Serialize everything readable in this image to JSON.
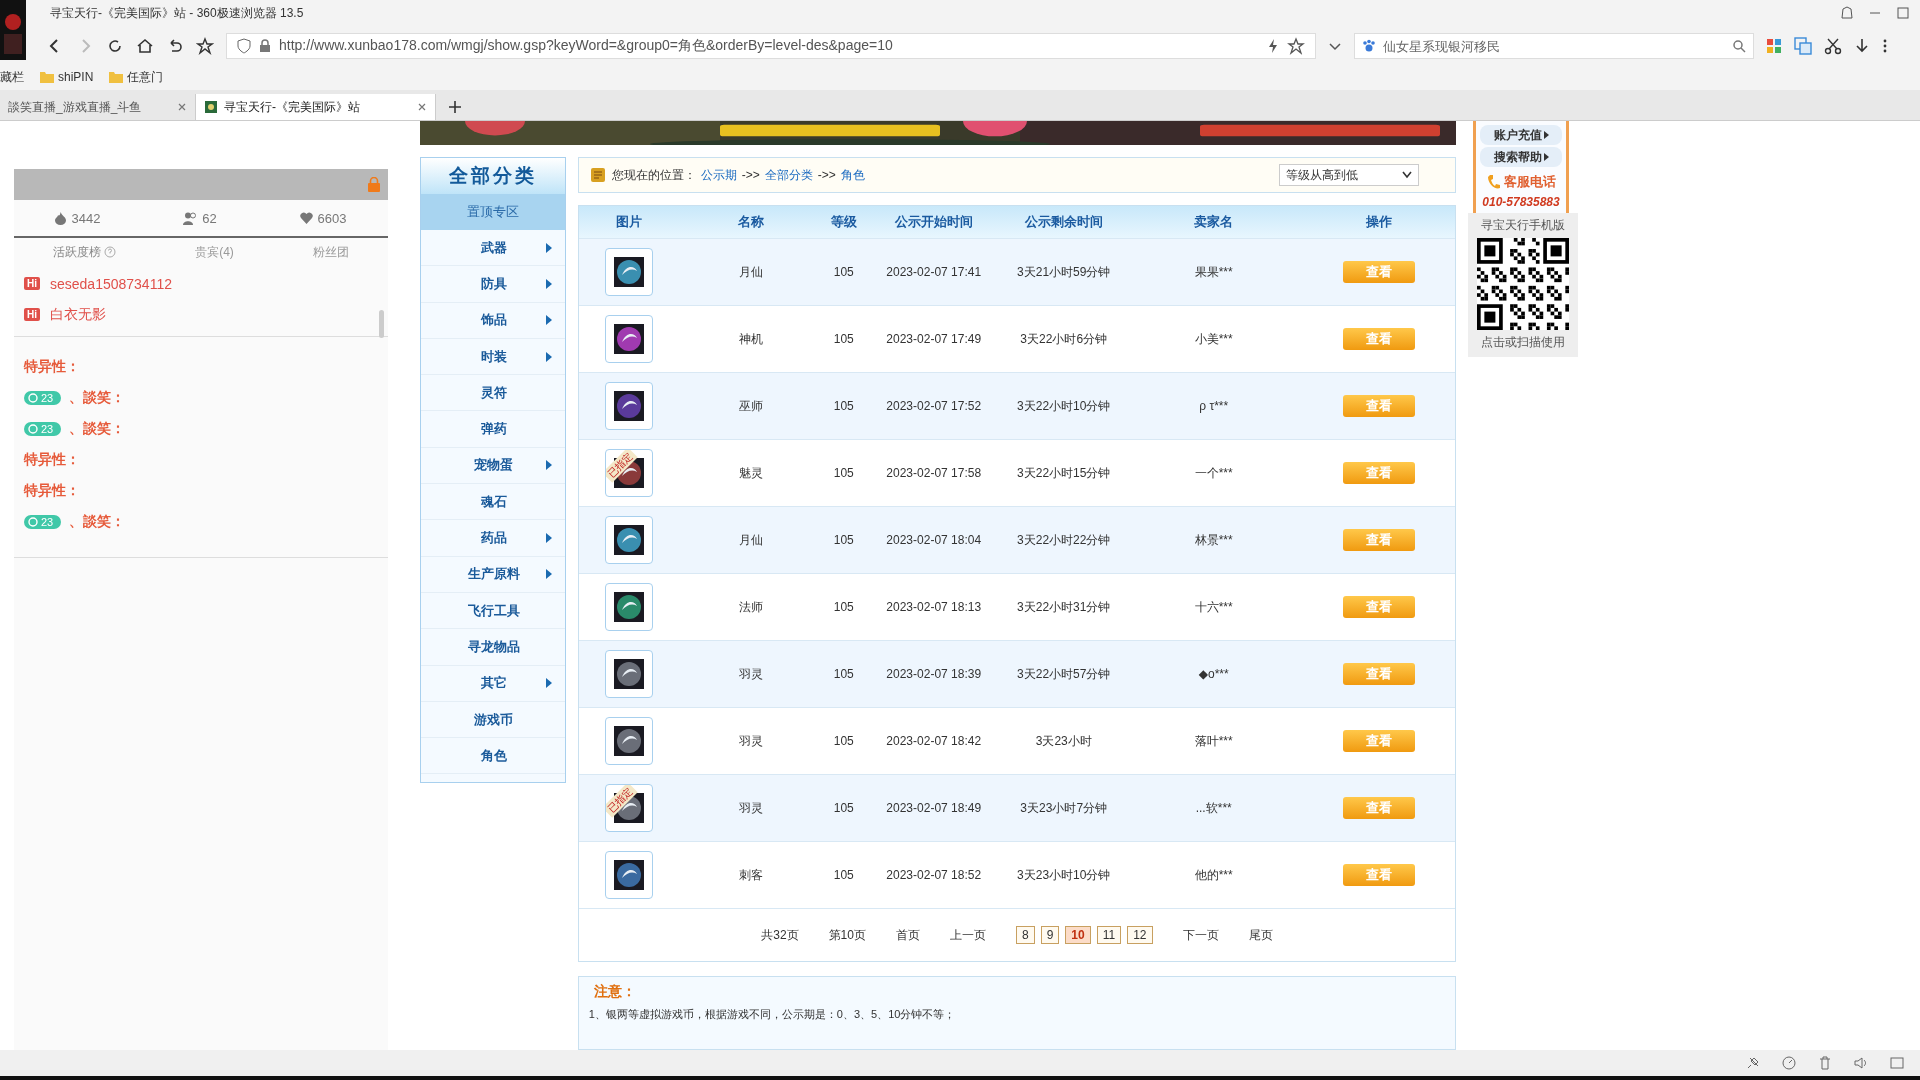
{
  "window": {
    "title": "寻宝天行-《完美国际》站 - 360极速浏览器 13.5"
  },
  "toolbar": {
    "url": "http://www.xunbao178.com/wmgj/show.gsp?keyWord=&group0=角色&orderBy=level-des&page=10",
    "search_placeholder": "仙女星系现银河移民"
  },
  "bookmarks": [
    "藏栏",
    "shiPIN",
    "任意门"
  ],
  "tabs": [
    {
      "label": "談笑直播_游戏直播_斗鱼",
      "selected": false
    },
    {
      "label": "寻宝天行-《完美国际》站",
      "selected": true
    }
  ],
  "side_panel": {
    "stats": [
      {
        "kind": "fire",
        "value": "3442"
      },
      {
        "kind": "people",
        "value": "62"
      },
      {
        "kind": "heart",
        "value": "6603"
      }
    ],
    "tabs": [
      {
        "label": "活跃度榜",
        "help": true,
        "selected": true
      },
      {
        "label": "贵宾(4)",
        "help": false,
        "selected": false
      },
      {
        "label": "粉丝团",
        "help": false,
        "selected": false
      }
    ],
    "users": [
      {
        "badge": "Hi",
        "name": "seseda1508734112"
      },
      {
        "badge": "Hi",
        "name": "白衣无影"
      }
    ],
    "messages": [
      {
        "kind": "trait",
        "text": "特异性："
      },
      {
        "kind": "chat",
        "level": "23",
        "text": "、談笑："
      },
      {
        "kind": "chat",
        "level": "23",
        "text": "、談笑："
      },
      {
        "kind": "trait",
        "text": "特异性："
      },
      {
        "kind": "trait",
        "text": "特异性："
      },
      {
        "kind": "chat",
        "level": "23",
        "text": "、談笑："
      }
    ]
  },
  "categories": {
    "title": "全部分类",
    "featured": "置顶专区",
    "items": [
      {
        "label": "武器",
        "has_submenu": true
      },
      {
        "label": "防具",
        "has_submenu": true
      },
      {
        "label": "饰品",
        "has_submenu": true
      },
      {
        "label": "时装",
        "has_submenu": true
      },
      {
        "label": "灵符",
        "has_submenu": false
      },
      {
        "label": "弹药",
        "has_submenu": false
      },
      {
        "label": "宠物蛋",
        "has_submenu": true
      },
      {
        "label": "魂石",
        "has_submenu": false
      },
      {
        "label": "药品",
        "has_submenu": true
      },
      {
        "label": "生产原料",
        "has_submenu": true
      },
      {
        "label": "飞行工具",
        "has_submenu": false
      },
      {
        "label": "寻龙物品",
        "has_submenu": false
      },
      {
        "label": "其它",
        "has_submenu": true
      },
      {
        "label": "游戏币",
        "has_submenu": false
      },
      {
        "label": "角色",
        "has_submenu": false
      }
    ]
  },
  "breadcrumb": [
    {
      "kind": "label",
      "text": "您现在的位置："
    },
    {
      "kind": "link",
      "text": "公示期"
    },
    {
      "kind": "separator",
      "text": "->>"
    },
    {
      "kind": "link",
      "text": "全部分类"
    },
    {
      "kind": "separator",
      "text": "->>"
    },
    {
      "kind": "link",
      "text": "角色"
    }
  ],
  "sort": {
    "value": "等级从高到低"
  },
  "table": {
    "columns": [
      "图片",
      "名称",
      "等级",
      "公示开始时间",
      "公示剩余时间",
      "卖家名",
      "操作"
    ],
    "rows": [
      {
        "color": "#3a8fb0",
        "name": "月仙",
        "level": "105",
        "start": "2023-02-07 17:41",
        "remaining": "3天21小时59分钟",
        "seller": "果果***",
        "action": "查看"
      },
      {
        "color": "#a03ab0",
        "name": "神机",
        "level": "105",
        "start": "2023-02-07 17:49",
        "remaining": "3天22小时6分钟",
        "seller": "小美***",
        "action": "查看"
      },
      {
        "color": "#5a3a9a",
        "name": "巫师",
        "level": "105",
        "start": "2023-02-07 17:52",
        "remaining": "3天22小时10分钟",
        "seller": "ρ τ***",
        "action": "查看"
      },
      {
        "color": "#8a3a3a",
        "tag": "已指定",
        "name": "魅灵",
        "level": "105",
        "start": "2023-02-07 17:58",
        "remaining": "3天22小时15分钟",
        "seller": "一个***",
        "action": "查看"
      },
      {
        "color": "#3a8fb0",
        "name": "月仙",
        "level": "105",
        "start": "2023-02-07 18:04",
        "remaining": "3天22小时22分钟",
        "seller": "林景***",
        "action": "查看"
      },
      {
        "color": "#2a8a6a",
        "name": "法师",
        "level": "105",
        "start": "2023-02-07 18:13",
        "remaining": "3天22小时31分钟",
        "seller": "十六***",
        "action": "查看"
      },
      {
        "color": "#6a6e78",
        "name": "羽灵",
        "level": "105",
        "start": "2023-02-07 18:39",
        "remaining": "3天22小时57分钟",
        "seller": "◆o***",
        "action": "查看"
      },
      {
        "color": "#6a6e78",
        "name": "羽灵",
        "level": "105",
        "start": "2023-02-07 18:42",
        "remaining": "3天23小时",
        "seller": "落叶***",
        "action": "查看"
      },
      {
        "color": "#6a6e78",
        "tag": "已指定",
        "name": "羽灵",
        "level": "105",
        "start": "2023-02-07 18:49",
        "remaining": "3天23小时7分钟",
        "seller": "...软***",
        "action": "查看"
      },
      {
        "color": "#3a6aa0",
        "name": "刺客",
        "level": "105",
        "start": "2023-02-07 18:52",
        "remaining": "3天23小时10分钟",
        "seller": "他的***",
        "action": "查看"
      }
    ]
  },
  "pagination": {
    "total": "共32页",
    "current": "第10页",
    "first": "首页",
    "prev": "上一页",
    "pages": [
      {
        "label": "8",
        "selected": false
      },
      {
        "label": "9",
        "selected": false
      },
      {
        "label": "10",
        "selected": true
      },
      {
        "label": "11",
        "selected": false
      },
      {
        "label": "12",
        "selected": false
      }
    ],
    "next": "下一页",
    "last": "尾页"
  },
  "notice": {
    "title": "注意：",
    "lines": [
      "1、银两等虚拟游戏币，根据游戏不同，公示期是：0、3、5、10分钟不等；"
    ]
  },
  "right_panel": {
    "buttons": [
      "账户充值",
      "搜索帮助"
    ],
    "phone_label": "客服电话",
    "phone": "010-57835883",
    "qr_title": "寻宝天行手机版",
    "qr_caption": "点击或扫描使用"
  }
}
